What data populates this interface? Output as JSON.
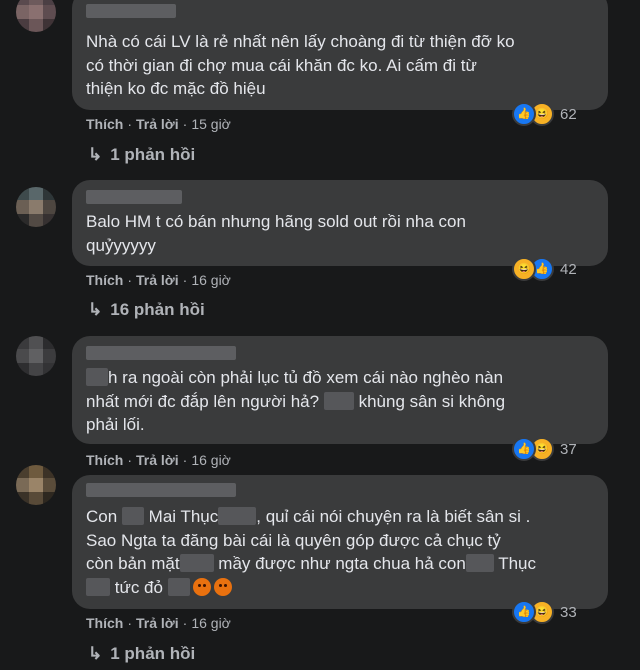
{
  "colors": {
    "background": "#18191a",
    "bubble": "#3a3b3c",
    "text": "#e4e6eb",
    "muted": "#b0b3b8",
    "like": "#1877f2",
    "haha": "#f7b125",
    "angry": "#e9710f"
  },
  "comments": [
    {
      "text_lines": [
        "Nhà có cái LV là rẻ nhất nên lấy choàng đi từ thiện đỡ ko",
        "có thời gian đi chợ mua cái khăn đc ko. Ai cấm đi từ",
        "thiện ko đc mặc đồ hiệu"
      ],
      "reaction_icons": [
        "like-icon",
        "haha-icon"
      ],
      "reaction_count": "62",
      "like_label": "Thích",
      "reply_label": "Trả lời",
      "time": "15 giờ",
      "replies_label": "1 phản hồi"
    },
    {
      "text_lines": [
        "Balo HM t có bán nhưng hãng sold out rồi nha con",
        "quỷyyyyy"
      ],
      "reaction_icons": [
        "haha-icon",
        "like-icon"
      ],
      "reaction_count": "42",
      "like_label": "Thích",
      "reply_label": "Trả lời",
      "time": "16 giờ",
      "replies_label": "16 phản hồi"
    },
    {
      "text_parts": [
        "h ra ngoài còn phải lục tủ đồ xem cái nào nghèo nàn",
        "nhất mới đc đắp lên người hả?",
        "khùng sân si không",
        "phải lối."
      ],
      "reaction_icons": [
        "like-icon",
        "haha-icon"
      ],
      "reaction_count": "37",
      "like_label": "Thích",
      "reply_label": "Trả lời",
      "time": "16 giờ"
    },
    {
      "text_parts": [
        "Con",
        "Mai Thục",
        ", quỉ cái nói chuyện ra là biết sân si .",
        "Sao Ngta ta đăng bài cái là quyên góp được cả chục tỷ",
        "còn bản mặt",
        "mầy được như ngta chua hả con",
        "Thục",
        "tức đỏ"
      ],
      "reaction_icons": [
        "like-icon",
        "haha-icon"
      ],
      "reaction_count": "33",
      "like_label": "Thích",
      "reply_label": "Trả lời",
      "time": "16 giờ",
      "replies_label": "1 phản hồi"
    }
  ]
}
